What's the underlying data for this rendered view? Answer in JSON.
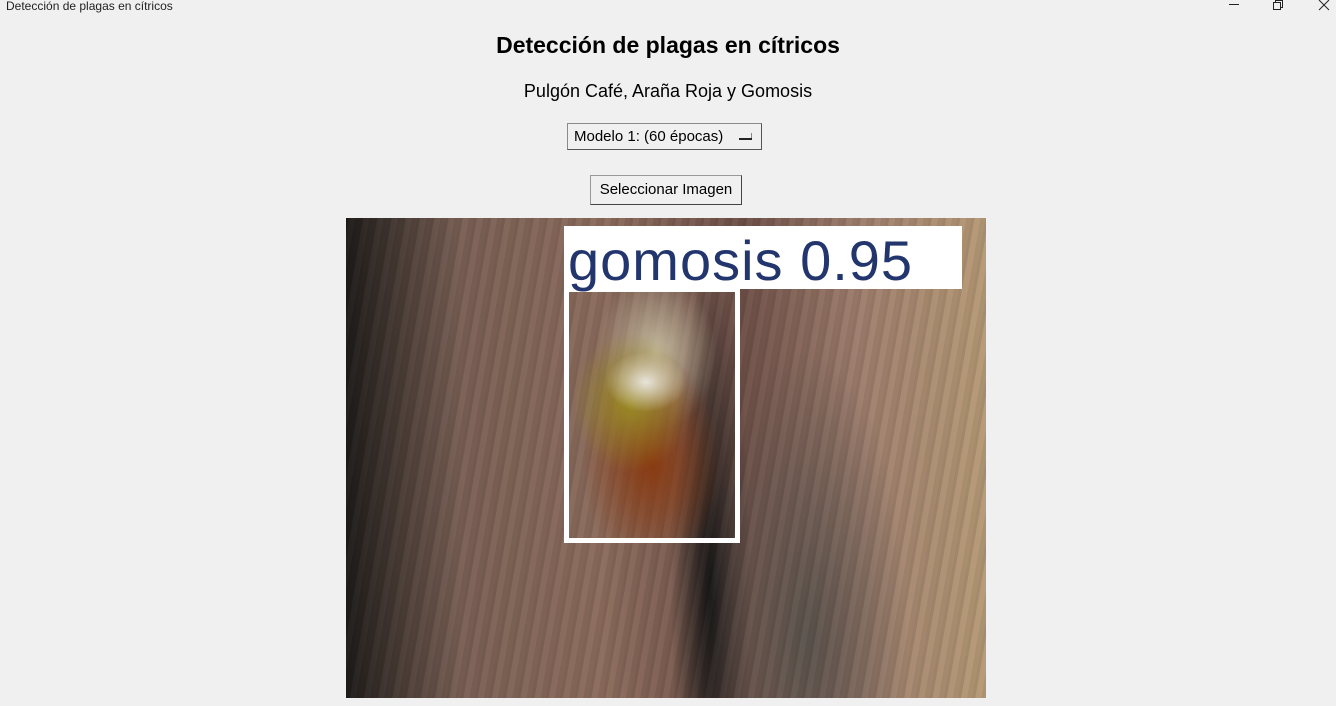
{
  "window": {
    "title": "Detección de plagas en cítricos",
    "controls": [
      "minimize-icon",
      "restore-icon",
      "close-icon"
    ]
  },
  "header": {
    "heading": "Detección de plagas en cítricos",
    "subtitle": "Pulgón Café, Araña Roja y Gomosis"
  },
  "model_selector": {
    "selected": "Modelo 1: (60 épocas)"
  },
  "actions": {
    "select_image_label": "Seleccionar Imagen"
  },
  "result_image": {
    "detection_label": "gomosis  0.95",
    "detection_class": "gomosis",
    "confidence": 0.95,
    "box_color": "#ffffff",
    "label_text_color": "#22356d"
  }
}
